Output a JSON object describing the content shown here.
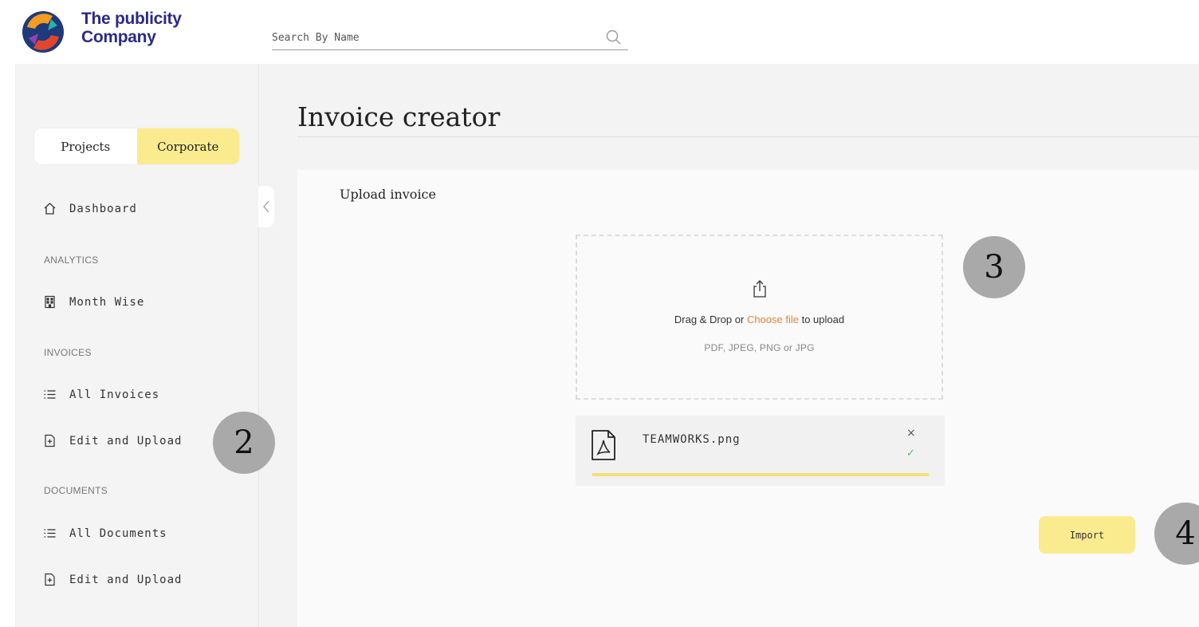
{
  "brand": {
    "line1": "The publicity",
    "line2": "Company"
  },
  "search": {
    "placeholder": "Search By Name"
  },
  "sidebar": {
    "toggle": [
      "Projects",
      "Corporate"
    ],
    "active_toggle": "Corporate",
    "dashboard": "Dashboard",
    "sections": {
      "analytics": "ANALYTICS",
      "invoices": "INVOICES",
      "documents": "DOCUMENTS"
    },
    "items": {
      "month_wise": "Month Wise",
      "all_invoices": "All Invoices",
      "invoice_edit_upload": "Edit and Upload",
      "all_documents": "All Documents",
      "document_edit_upload": "Edit and Upload"
    }
  },
  "main": {
    "title": "Invoice creator",
    "card_title": "Upload invoice",
    "dropzone": {
      "text_before": "Drag & Drop or ",
      "link": "Choose file",
      "text_after": " to upload",
      "formats": "PDF, JPEG, PNG or JPG"
    },
    "file": {
      "name": "TEAMWORKS.png",
      "close": "×",
      "check": "✓",
      "progress": 1.0
    },
    "import_label": "Import"
  },
  "annotations": [
    "2",
    "3",
    "4"
  ],
  "colors": {
    "accent_yellow": "#fbeb8f",
    "link_orange": "#e8823a",
    "brand_navy": "#2a2a8c",
    "success_green": "#59b86a"
  },
  "icons": [
    "logo-icon",
    "search-icon",
    "home-icon",
    "building-icon",
    "list-icon",
    "file-plus-icon",
    "chevron-left-icon",
    "upload-icon",
    "pdf-file-icon"
  ]
}
